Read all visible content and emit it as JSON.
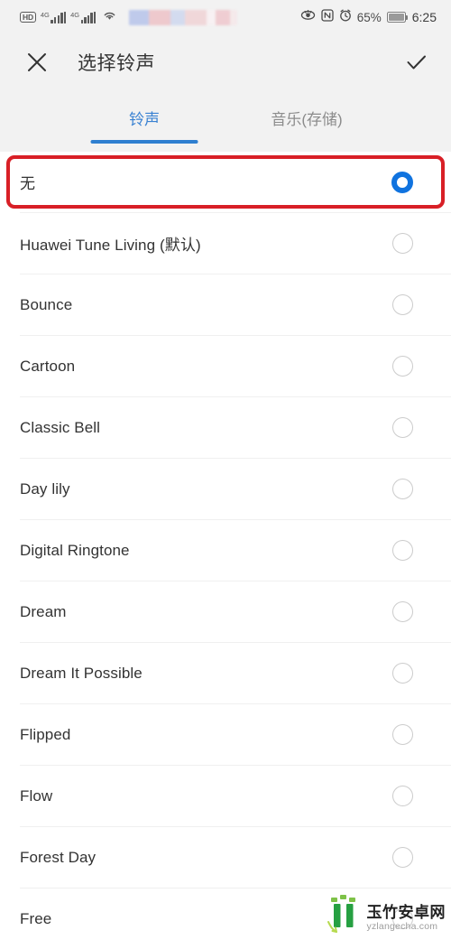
{
  "status_bar": {
    "hd_badge": "HD",
    "sim1_network": "4G",
    "sim2_network": "4G",
    "wifi_icon": "wifi-icon",
    "eye_icon": "eye-comfort-icon",
    "nfc_icon": "nfc-icon",
    "alarm_icon": "alarm-clock-icon",
    "battery_percent": "65%",
    "time": "6:25"
  },
  "app_bar": {
    "close_icon": "close-icon",
    "title": "选择铃声",
    "confirm_icon": "check-icon"
  },
  "tabs": [
    {
      "label": "铃声",
      "active": true
    },
    {
      "label": "音乐(存储)",
      "active": false
    }
  ],
  "ringtones": [
    {
      "label": "无",
      "selected": true
    },
    {
      "label": "Huawei Tune Living (默认)",
      "selected": false
    },
    {
      "label": "Bounce",
      "selected": false
    },
    {
      "label": "Cartoon",
      "selected": false
    },
    {
      "label": "Classic Bell",
      "selected": false
    },
    {
      "label": "Day lily",
      "selected": false
    },
    {
      "label": "Digital Ringtone",
      "selected": false
    },
    {
      "label": "Dream",
      "selected": false
    },
    {
      "label": "Dream It Possible",
      "selected": false
    },
    {
      "label": "Flipped",
      "selected": false
    },
    {
      "label": "Flow",
      "selected": false
    },
    {
      "label": "Forest Day",
      "selected": false
    },
    {
      "label": "Free",
      "selected": false
    }
  ],
  "annotation": {
    "color": "#d81f26",
    "target": "无"
  },
  "watermark": {
    "title": "玉竹安卓网",
    "url": "yzlangecha.com"
  },
  "colors": {
    "accent_blue": "#1073df",
    "tab_active": "#3a82d2",
    "bar_background": "#f2f2f2",
    "text_primary": "#333333",
    "text_muted": "#8c8c8c",
    "annotation_red": "#d81f26"
  }
}
